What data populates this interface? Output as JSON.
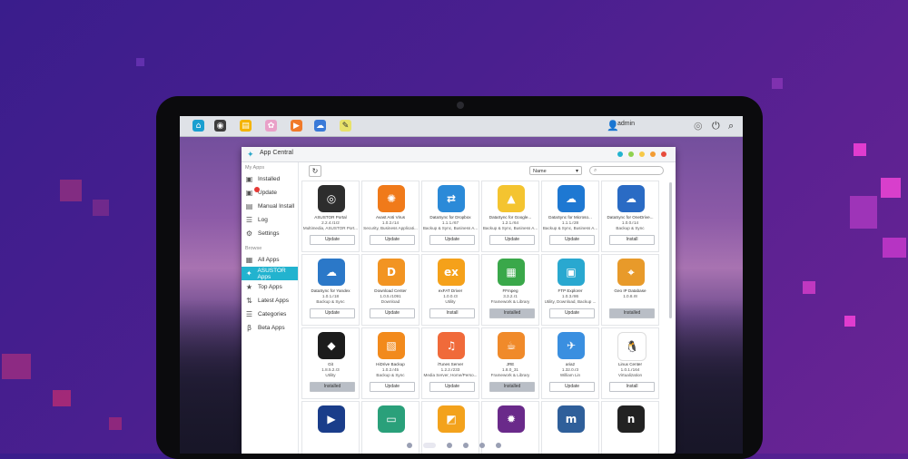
{
  "window": {
    "title": "App Central"
  },
  "topbar": {
    "user": "admin"
  },
  "sidebar": {
    "my_apps_header": "My Apps",
    "my_apps": [
      {
        "label": "Installed",
        "icon": "installed-icon"
      },
      {
        "label": "Update",
        "icon": "update-icon"
      },
      {
        "label": "Manual Install",
        "icon": "manual-install-icon"
      },
      {
        "label": "Log",
        "icon": "log-icon"
      },
      {
        "label": "Settings",
        "icon": "settings-icon"
      }
    ],
    "browse_header": "Browse",
    "browse": [
      {
        "label": "All Apps",
        "icon": "all-apps-icon"
      },
      {
        "label": "ASUSTOR Apps",
        "icon": "asustor-apps-icon"
      },
      {
        "label": "Top Apps",
        "icon": "top-apps-icon"
      },
      {
        "label": "Latest Apps",
        "icon": "latest-apps-icon"
      },
      {
        "label": "Categories",
        "icon": "categories-icon"
      },
      {
        "label": "Beta Apps",
        "icon": "beta-apps-icon"
      }
    ]
  },
  "toolbar": {
    "sort_value": "Name"
  },
  "apps": [
    {
      "name": "ASUSTOR Portal",
      "version": "2.2.4.r1r2",
      "category": "Multimedia, ASUSTOR Port...",
      "button": "Update",
      "color": "#2d2d2d",
      "icon": "asustor-portal-icon"
    },
    {
      "name": "Avast Anti Virus",
      "version": "1.0.2.r14",
      "category": "Security, Business Applicati...",
      "button": "Update",
      "color": "#f07a1a",
      "icon": "avast-icon"
    },
    {
      "name": "DataSync for Dropbox",
      "version": "1.1.1.r67",
      "category": "Backup & Sync, Business A...",
      "button": "Update",
      "color": "#2b8ad8",
      "icon": "dropbox-sync-icon"
    },
    {
      "name": "DataSync for Google...",
      "version": "1.2.1.r64",
      "category": "Backup & Sync, Business A...",
      "button": "Update",
      "color": "#f4c430",
      "icon": "google-drive-icon"
    },
    {
      "name": "DataSync for Microso...",
      "version": "1.1.1.r28",
      "category": "Backup & Sync, Business A...",
      "button": "Update",
      "color": "#1e78d2",
      "icon": "onedrive-icon"
    },
    {
      "name": "DataSync for OneDrive...",
      "version": "1.0.0.r14",
      "category": "Backup & Sync",
      "button": "Install",
      "color": "#2a6bc4",
      "icon": "onedrive-business-icon"
    },
    {
      "name": "DataSync for Yandex",
      "version": "1.0.1.r18",
      "category": "Backup & Sync",
      "button": "Update",
      "color": "#2b78c8",
      "icon": "yandex-disk-icon"
    },
    {
      "name": "Download Center",
      "version": "1.0.5.r1091",
      "category": "Download",
      "button": "Update",
      "color": "#f29422",
      "icon": "download-center-icon"
    },
    {
      "name": "exFAT Driver",
      "version": "1.0.0.r3",
      "category": "Utility",
      "button": "Install",
      "color": "#f5a11a",
      "icon": "exfat-icon"
    },
    {
      "name": "FFmpeg",
      "version": "3.3.2.r1",
      "category": "Framework & Library",
      "button": "Installed",
      "color": "#3aa84a",
      "icon": "ffmpeg-icon"
    },
    {
      "name": "FTP Explorer",
      "version": "1.0.3.r86",
      "category": "Utility, Download, Backup ...",
      "button": "Update",
      "color": "#29a8d0",
      "icon": "ftp-explorer-icon"
    },
    {
      "name": "Geo IP Database",
      "version": "1.0.8.r8",
      "category": "",
      "button": "Installed",
      "color": "#e89a2a",
      "icon": "geo-ip-icon"
    },
    {
      "name": "Git",
      "version": "1.8.5.2.r3",
      "category": "Utility",
      "button": "Installed",
      "color": "#1c1c1c",
      "icon": "git-icon"
    },
    {
      "name": "HiDrive Backup",
      "version": "1.0.2.r45",
      "category": "Backup & Sync",
      "button": "Update",
      "color": "#f28a1c",
      "icon": "hidrive-icon"
    },
    {
      "name": "iTunes Server",
      "version": "1.2.2.r233",
      "category": "Media Server, Home/Perso...",
      "button": "Update",
      "color": "#f06a3a",
      "icon": "itunes-server-icon"
    },
    {
      "name": "JRE",
      "version": "1.8.0_31",
      "category": "Framework & Library",
      "button": "Installed",
      "color": "#f08a2a",
      "icon": "java-icon"
    },
    {
      "name": "aria2",
      "version": "1.32.0.r3",
      "category": "William Lin",
      "button": "Update",
      "color": "#3a8fe0",
      "icon": "aria2-icon"
    },
    {
      "name": "Linux Center",
      "version": "1.0.1.r164",
      "category": "Virtualization",
      "button": "Install",
      "color": "#ffffff",
      "icon": "linux-tux-icon"
    },
    {
      "name": "",
      "version": "",
      "category": "",
      "button": "",
      "color": "#1a3d8a",
      "icon": "media-app-icon"
    },
    {
      "name": "",
      "version": "",
      "category": "",
      "button": "",
      "color": "#2aa07a",
      "icon": "monitor-app-icon"
    },
    {
      "name": "",
      "version": "",
      "category": "",
      "button": "",
      "color": "#f3a21c",
      "icon": "cast-app-icon"
    },
    {
      "name": "",
      "version": "",
      "category": "",
      "button": "",
      "color": "#6a2a8a",
      "icon": "gear-app-icon"
    },
    {
      "name": "",
      "version": "",
      "category": "",
      "button": "",
      "color": "#2f5f9a",
      "icon": "mono-app-icon"
    },
    {
      "name": "",
      "version": "",
      "category": "",
      "button": "",
      "color": "#222222",
      "icon": "nodejs-app-icon"
    }
  ],
  "colors": {
    "accent": "#22b3cf",
    "background": "#4a1f8f"
  }
}
